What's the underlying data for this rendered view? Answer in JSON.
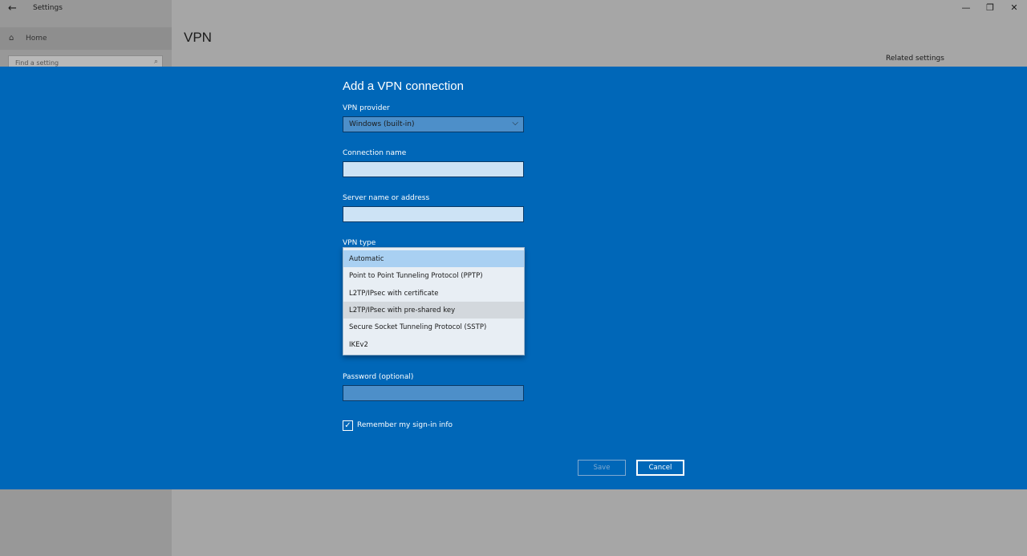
{
  "window": {
    "title": "Settings",
    "back_icon": "←",
    "controls": [
      "—",
      "❐",
      "✕"
    ]
  },
  "sidebar": {
    "home_icon": "⌂",
    "home_label": "Home",
    "search_placeholder": "Find a setting",
    "search_icon": "⌕"
  },
  "main": {
    "heading": "VPN",
    "related_settings": "Related settings"
  },
  "dialog": {
    "title": "Add a VPN connection",
    "provider_label": "VPN provider",
    "provider_value": "Windows (built-in)",
    "chevron": "⌵",
    "connection_name_label": "Connection name",
    "connection_name_value": "",
    "server_label": "Server name or address",
    "server_value": "",
    "vpn_type_label": "VPN type",
    "vpn_type_options": [
      "Automatic",
      "Point to Point Tunneling Protocol (PPTP)",
      "L2TP/IPsec with certificate",
      "L2TP/IPsec with pre-shared key",
      "Secure Socket Tunneling Protocol (SSTP)",
      "IKEv2"
    ],
    "vpn_type_selected": "Automatic",
    "vpn_type_hovered": "L2TP/IPsec with pre-shared key",
    "password_label": "Password (optional)",
    "password_value": "",
    "remember_label": "Remember my sign-in info",
    "remember_checked": true,
    "check_glyph": "✓",
    "save_label": "Save",
    "cancel_label": "Cancel"
  },
  "colors": {
    "dialog_bg": "#0067b8",
    "selected_option": "#a9d0f2",
    "hover_option": "#d3d8dd"
  }
}
